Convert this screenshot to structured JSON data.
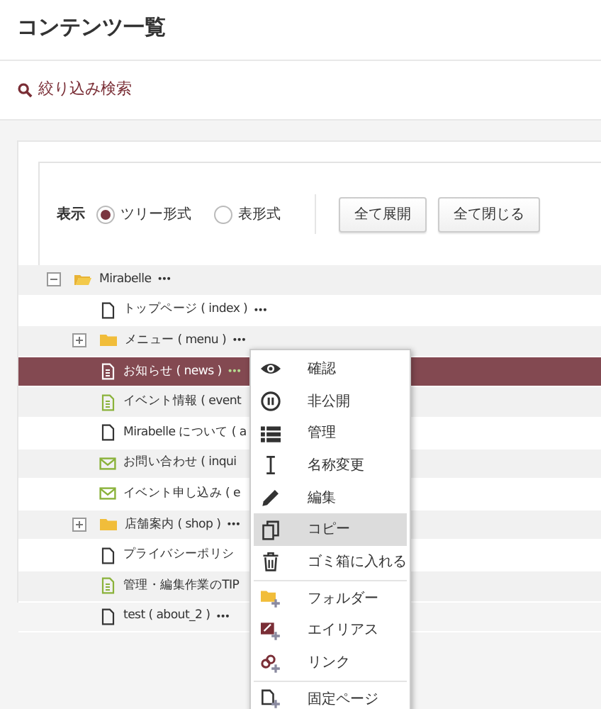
{
  "page_title": "コンテンツ一覧",
  "filter_link": "絞り込み検索",
  "toolbar": {
    "label": "表示",
    "views": [
      {
        "label": "ツリー形式",
        "selected": true
      },
      {
        "label": "表形式",
        "selected": false
      }
    ],
    "buttons": [
      "全て展開",
      "全て閉じる"
    ]
  },
  "tree": [
    {
      "label": "Mirabelle",
      "more": "•••",
      "kind": "folder",
      "expanded": true,
      "selected": false,
      "children": [
        {
          "label": "トップページ ( index )",
          "more": "•••",
          "kind": "page",
          "selected": false
        },
        {
          "label": "メニュー ( menu )",
          "more": "•••",
          "kind": "folder",
          "expanded": false,
          "selected": false
        },
        {
          "label": "お知らせ ( news )",
          "more": "•••",
          "kind": "blog",
          "selected": true
        },
        {
          "label": "イベント情報 ( event",
          "kind": "blog",
          "selected": false
        },
        {
          "label": "Mirabelle について ( a",
          "kind": "page",
          "selected": false
        },
        {
          "label": "お問い合わせ ( inqui",
          "kind": "mail",
          "selected": false
        },
        {
          "label": "イベント申し込み ( e",
          "kind": "mail",
          "selected": false
        },
        {
          "label": "店舗案内 ( shop )",
          "more": "•••",
          "kind": "folder",
          "expanded": false,
          "selected": false
        },
        {
          "label": "プライバシーポリシ",
          "kind": "page",
          "selected": false
        },
        {
          "label": "管理・編集作業のTIP",
          "kind": "blog",
          "selected": false
        },
        {
          "label": "test ( about_2 )",
          "more": "•••",
          "kind": "page",
          "selected": false
        }
      ]
    }
  ],
  "context_menu": [
    {
      "label": "確認",
      "kind": "eye",
      "selected": false
    },
    {
      "label": "非公開",
      "kind": "pause",
      "selected": false
    },
    {
      "label": "管理",
      "kind": "list",
      "selected": false
    },
    {
      "label": "名称変更",
      "kind": "cursor",
      "selected": false
    },
    {
      "label": "編集",
      "kind": "pencil",
      "selected": false
    },
    {
      "label": "コピー",
      "kind": "copy",
      "selected": true
    },
    {
      "label": "ゴミ箱に入れる",
      "kind": "trash",
      "selected": false,
      "divider_after": true
    },
    {
      "label": "フォルダー",
      "kind": "add-folder",
      "selected": false
    },
    {
      "label": "エイリアス",
      "kind": "add-alias",
      "selected": false
    },
    {
      "label": "リンク",
      "kind": "add-link",
      "selected": false,
      "divider_after": true
    },
    {
      "label": "固定ページ",
      "kind": "add-page",
      "selected": false
    }
  ]
}
